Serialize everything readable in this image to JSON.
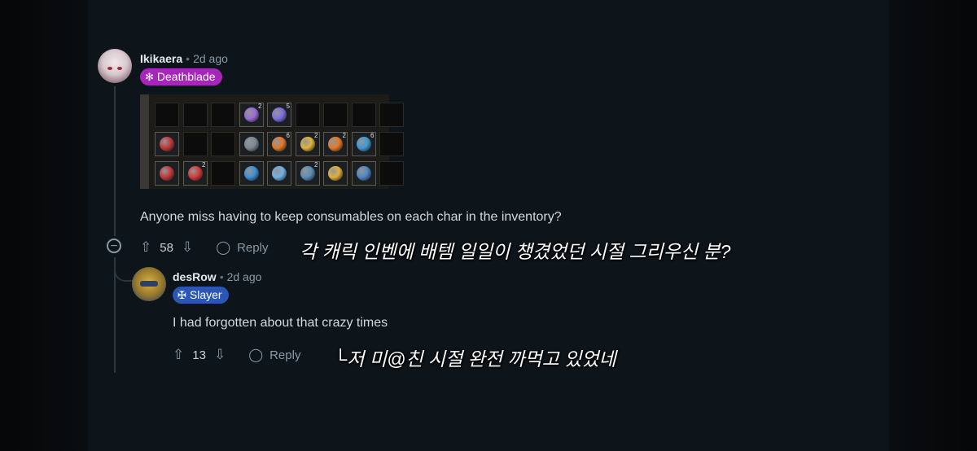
{
  "comment1": {
    "username": "Ikikaera",
    "time": "2d ago",
    "flair": "Deathblade",
    "text": "Anyone miss having to keep consumables on each char in the inventory?",
    "votes": "58",
    "reply_label": "Reply"
  },
  "comment2": {
    "username": "desRow",
    "time": "2d ago",
    "flair": "Slayer",
    "text": "I had forgotten about that crazy times",
    "votes": "13",
    "reply_label": "Reply"
  },
  "subtitles": {
    "line1": "각 캐릭 인벤에 배템 일일이 챙겼었던 시절 그리우신 분?",
    "line2": "└저 미@친 시절 완전 까먹고 있었네"
  },
  "colors": {
    "background": "#0d141a",
    "flair_deathblade": "#a526b8",
    "flair_slayer": "#2b56b3",
    "text": "#d3dade"
  },
  "icons": {
    "upvote": "arrow-up-icon",
    "downvote": "arrow-down-icon",
    "reply": "speech-bubble-icon",
    "collapse": "minus-circle-icon"
  },
  "inventory_counts": {
    "r0c3": "2",
    "r0c4": "5",
    "r1c4": "6",
    "r1c5": "2",
    "r1c6": "2",
    "r1c7": "6",
    "r2c1": "2",
    "r2c5": "2"
  }
}
